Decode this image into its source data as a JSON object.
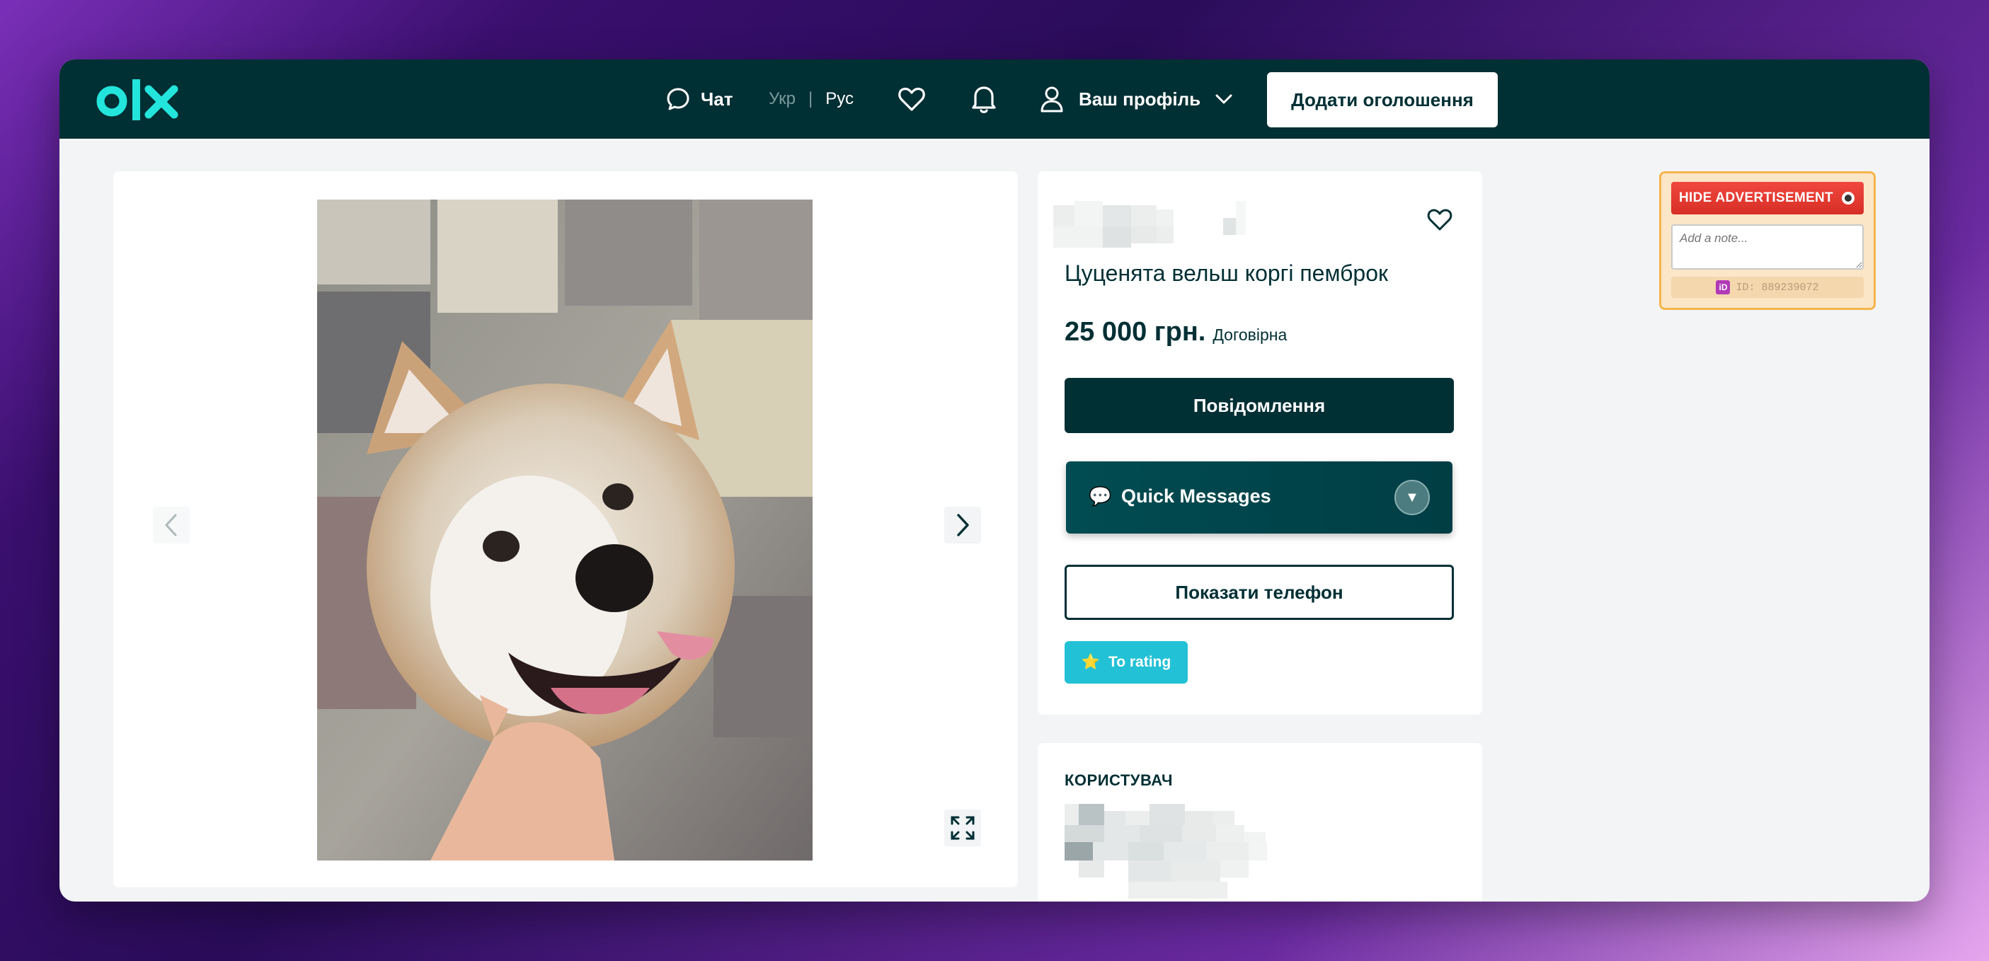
{
  "header": {
    "logo_text": "olx",
    "chat_label": "Чат",
    "lang_uk": "Укр",
    "lang_sep": "|",
    "lang_ru": "Рус",
    "profile_label": "Ваш профіль",
    "add_listing_label": "Додати оголошення"
  },
  "listing": {
    "title": "Цуценята вельш коргі пемброк",
    "price": "25 000 грн.",
    "negotiable": "Договірна",
    "message_button": "Повідомлення",
    "quick_messages_label": "Quick Messages",
    "show_phone_button": "Показати телефон",
    "rating_button": "To rating"
  },
  "user_section": {
    "label": "КОРИСТУВАЧ"
  },
  "extension": {
    "hide_label": "HIDE ADVERTISEMENT",
    "note_placeholder": "Add a note...",
    "id_text": "ID: 889239072"
  },
  "colors": {
    "olx_dark": "#002f34",
    "olx_teal": "#23e5db",
    "rating_cyan": "#23c1d6",
    "hide_red": "#e0372f",
    "ext_bg": "#fbe6c8"
  }
}
